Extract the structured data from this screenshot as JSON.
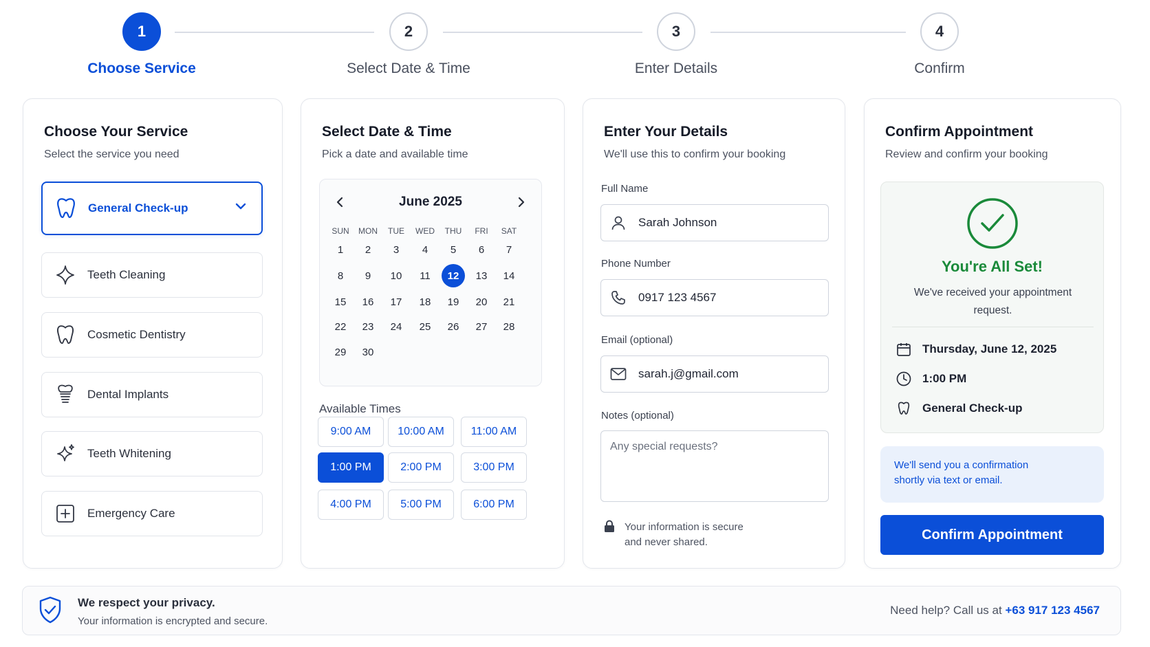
{
  "stepper": {
    "steps": [
      {
        "number": "1",
        "label": "Choose Service"
      },
      {
        "number": "2",
        "label": "Select Date & Time"
      },
      {
        "number": "3",
        "label": "Enter Details"
      },
      {
        "number": "4",
        "label": "Confirm"
      }
    ],
    "active_step": 1
  },
  "service_card": {
    "title": "Choose Your Service",
    "subtitle": "Select the service you need",
    "services": [
      {
        "label": "General Check-up",
        "icon": "tooth-icon",
        "selected": true
      },
      {
        "label": "Teeth Cleaning",
        "icon": "sparkle-icon"
      },
      {
        "label": "Cosmetic Dentistry",
        "icon": "tooth-icon"
      },
      {
        "label": "Dental Implants",
        "icon": "implant-icon"
      },
      {
        "label": "Teeth Whitening",
        "icon": "sparkles-icon"
      },
      {
        "label": "Emergency Care",
        "icon": "plus-square-icon"
      }
    ]
  },
  "datetime_card": {
    "title": "Select Date & Time",
    "subtitle": "Pick a date and available time",
    "calendar": {
      "month": "June 2025",
      "weekdays": [
        "SUN",
        "MON",
        "TUE",
        "WED",
        "THU",
        "FRI",
        "SAT"
      ],
      "days": [
        "1",
        "2",
        "3",
        "4",
        "5",
        "6",
        "7",
        "8",
        "9",
        "10",
        "11",
        "12",
        "13",
        "14",
        "15",
        "16",
        "17",
        "18",
        "19",
        "20",
        "21",
        "22",
        "23",
        "24",
        "25",
        "26",
        "27",
        "28",
        "29",
        "30"
      ],
      "selected_day": "12"
    },
    "times_label": "Available Times",
    "times": [
      "9:00 AM",
      "10:00 AM",
      "11:00 AM",
      "1:00 PM",
      "2:00 PM",
      "3:00 PM",
      "4:00 PM",
      "5:00 PM",
      "6:00 PM"
    ],
    "selected_time": "1:00 PM"
  },
  "details_card": {
    "title": "Enter Your Details",
    "subtitle": "We'll use this to confirm your booking",
    "full_name_label": "Full Name",
    "full_name_value": "Sarah Johnson",
    "phone_label": "Phone Number",
    "phone_value": "0917 123 4567",
    "email_label": "Email (optional)",
    "email_value": "sarah.j@gmail.com",
    "notes_label": "Notes (optional)",
    "notes_placeholder": "Any special requests?",
    "secure_line1": "Your information is secure",
    "secure_line2": "and never shared."
  },
  "confirm_card": {
    "title": "Confirm Appointment",
    "subtitle": "Review and confirm your booking",
    "success_title": "You're All Set!",
    "success_message": "We've received your appointment request.",
    "date": "Thursday, June 12, 2025",
    "time": "1:00 PM",
    "service": "General Check-up",
    "info_line1": "We'll send you a confirmation",
    "info_line2": "shortly via text or email.",
    "button_label": "Confirm Appointment"
  },
  "footer": {
    "privacy_title": "We respect your privacy.",
    "privacy_subtitle": "Your information is encrypted and secure.",
    "help_text": "Need help? Call us at",
    "help_phone": "+63 917 123 4567"
  },
  "colors": {
    "primary": "#0b4fd8",
    "success": "#1a8a3a",
    "border": "#e3e6ec",
    "info_bg": "#eaf1fc"
  }
}
